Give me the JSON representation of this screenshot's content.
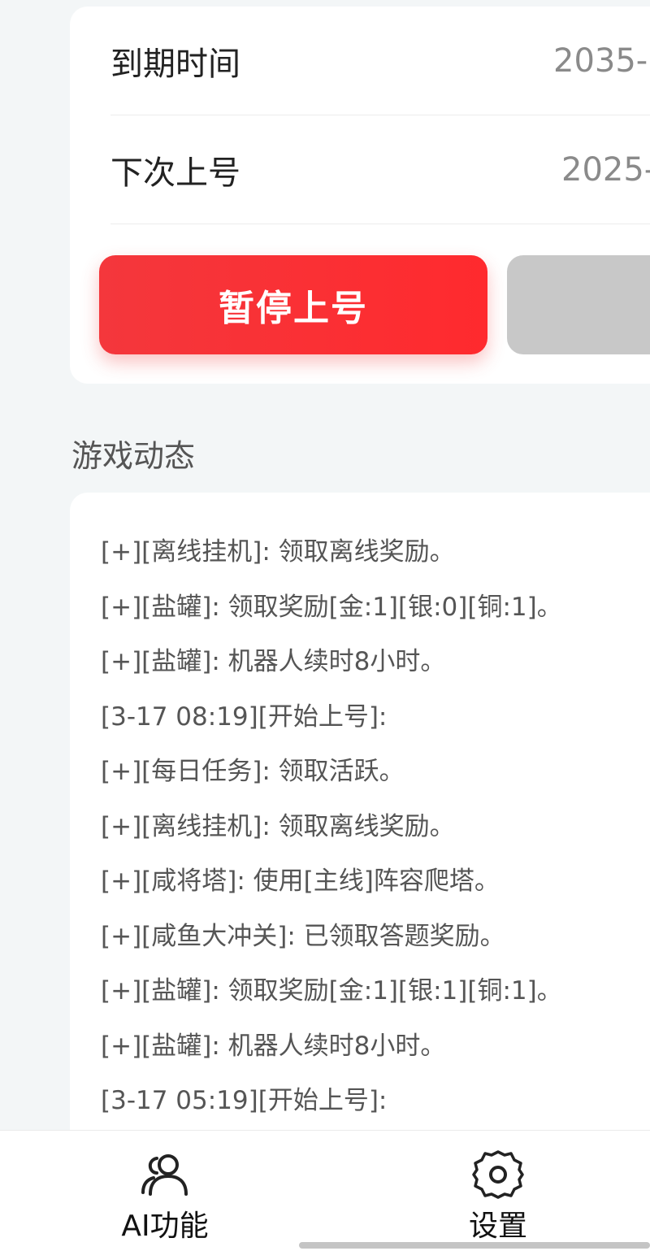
{
  "account": {
    "expire_label": "到期时间",
    "expire_value": "2035-",
    "next_login_label": "下次上号",
    "next_login_value": "2025-",
    "pause_button": "暂停上号"
  },
  "colors": {
    "primary_red": "#f4373c",
    "secondary_button": "#c8c8c8",
    "background": "#f3f6f7"
  },
  "game_log": {
    "title": "游戏动态",
    "lines": [
      "[+][离线挂机]: 领取离线奖励。",
      "[+][盐罐]: 领取奖励[金:1][银:0][铜:1]。",
      "[+][盐罐]: 机器人续时8小时。",
      "[3-17 08:19][开始上号]:",
      "[+][每日任务]: 领取活跃。",
      "[+][离线挂机]: 领取离线奖励。",
      "[+][咸将塔]: 使用[主线]阵容爬塔。",
      "[+][咸鱼大冲关]: 已领取答题奖励。",
      "[+][盐罐]: 领取奖励[金:1][银:1][铜:1]。",
      "[+][盐罐]: 机器人续时8小时。",
      "[3-17 05:19][开始上号]:"
    ]
  },
  "nav": {
    "items": [
      {
        "label": "AI功能",
        "icon": "users-icon"
      },
      {
        "label": "设置",
        "icon": "gear-icon"
      }
    ]
  }
}
